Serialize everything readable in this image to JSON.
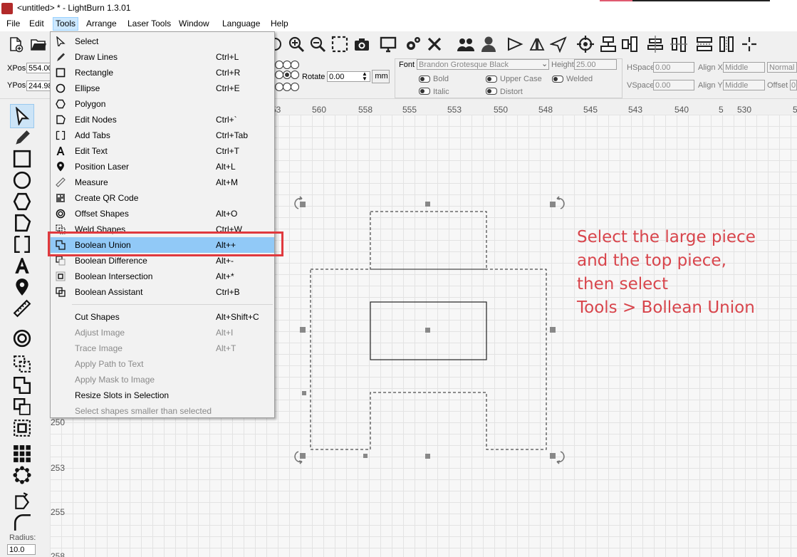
{
  "window": {
    "title": "<untitled> * - LightBurn 1.3.01"
  },
  "menubar": [
    "File",
    "Edit",
    "Tools",
    "Arrange",
    "Laser Tools",
    "Window",
    "Language",
    "Help"
  ],
  "properties": {
    "xpos_label": "XPos",
    "xpos_value": "554.00",
    "ypos_label": "YPos",
    "ypos_value": "244.98",
    "rotate_label": "Rotate",
    "rotate_value": "0.00",
    "rotate_unit": "mm",
    "font_label": "Font",
    "font_value": "Brandon Grotesque Black",
    "height_label": "Height",
    "height_value": "25.00",
    "bold": "Bold",
    "italic": "Italic",
    "upper_case": "Upper Case",
    "distort": "Distort",
    "welded": "Welded",
    "hspace_label": "HSpace",
    "hspace_value": "0.00",
    "vspace_label": "VSpace",
    "vspace_value": "0.00",
    "alignx_label": "Align X",
    "alignx_value": "Middle",
    "aligny_label": "Align Y",
    "aligny_value": "Middle",
    "normal_value": "Normal",
    "offset_label": "Offset",
    "offset_value": "0"
  },
  "ruler": {
    "top": [
      "53",
      "560",
      "558",
      "555",
      "553",
      "550",
      "548",
      "545",
      "543",
      "540",
      "5",
      "530",
      "5"
    ],
    "left": [
      "250",
      "253",
      "255",
      "258"
    ]
  },
  "left_toolbar": {
    "radius_label": "Radius:",
    "radius_value": "10.0"
  },
  "tools_menu": {
    "items": [
      {
        "label": "Select",
        "shortcut": "",
        "icon": "cursor-icon",
        "disabled": false
      },
      {
        "label": "Draw Lines",
        "shortcut": "Ctrl+L",
        "icon": "pen-icon",
        "disabled": false
      },
      {
        "label": "Rectangle",
        "shortcut": "Ctrl+R",
        "icon": "rectangle-icon",
        "disabled": false
      },
      {
        "label": "Ellipse",
        "shortcut": "Ctrl+E",
        "icon": "ellipse-icon",
        "disabled": false
      },
      {
        "label": "Polygon",
        "shortcut": "",
        "icon": "polygon-icon",
        "disabled": false
      },
      {
        "label": "Edit Nodes",
        "shortcut": "Ctrl+`",
        "icon": "edit-nodes-icon",
        "disabled": false
      },
      {
        "label": "Add Tabs",
        "shortcut": "Ctrl+Tab",
        "icon": "add-tabs-icon",
        "disabled": false
      },
      {
        "label": "Edit Text",
        "shortcut": "Ctrl+T",
        "icon": "text-icon",
        "disabled": false
      },
      {
        "label": "Position Laser",
        "shortcut": "Alt+L",
        "icon": "position-laser-icon",
        "disabled": false
      },
      {
        "label": "Measure",
        "shortcut": "Alt+M",
        "icon": "measure-icon",
        "disabled": false
      },
      {
        "label": "Create QR Code",
        "shortcut": "",
        "icon": "qr-code-icon",
        "disabled": false
      },
      {
        "label": "Offset Shapes",
        "shortcut": "Alt+O",
        "icon": "offset-icon",
        "disabled": false
      },
      {
        "label": "Weld Shapes",
        "shortcut": "Ctrl+W",
        "icon": "weld-icon",
        "disabled": false
      },
      {
        "label": "Boolean Union",
        "shortcut": "Alt++",
        "icon": "boolean-union-icon",
        "disabled": false,
        "highlighted": true
      },
      {
        "label": "Boolean Difference",
        "shortcut": "Alt+-",
        "icon": "boolean-difference-icon",
        "disabled": false
      },
      {
        "label": "Boolean Intersection",
        "shortcut": "Alt+*",
        "icon": "boolean-intersection-icon",
        "disabled": false
      },
      {
        "label": "Boolean Assistant",
        "shortcut": "Ctrl+B",
        "icon": "boolean-assistant-icon",
        "disabled": false
      },
      {
        "separator": true
      },
      {
        "label": "Cut Shapes",
        "shortcut": "Alt+Shift+C",
        "icon": "",
        "disabled": false
      },
      {
        "label": "Adjust Image",
        "shortcut": "Alt+I",
        "icon": "",
        "disabled": true
      },
      {
        "label": "Trace Image",
        "shortcut": "Alt+T",
        "icon": "",
        "disabled": true
      },
      {
        "label": "Apply Path to Text",
        "shortcut": "",
        "icon": "",
        "disabled": true
      },
      {
        "label": "Apply Mask to Image",
        "shortcut": "",
        "icon": "",
        "disabled": true
      },
      {
        "label": "Resize Slots in Selection",
        "shortcut": "",
        "icon": "",
        "disabled": false
      },
      {
        "label": "Select shapes smaller than selected",
        "shortcut": "",
        "icon": "",
        "disabled": true
      }
    ]
  },
  "annotation": {
    "text": "Select the large piece\nand the top piece,\nthen select\nTools > Bollean Union",
    "color": "#d8454c"
  },
  "colors": {
    "highlight": "#91c9f7",
    "callout_box": "#e0393e",
    "menu_active": "#cce8ff"
  }
}
